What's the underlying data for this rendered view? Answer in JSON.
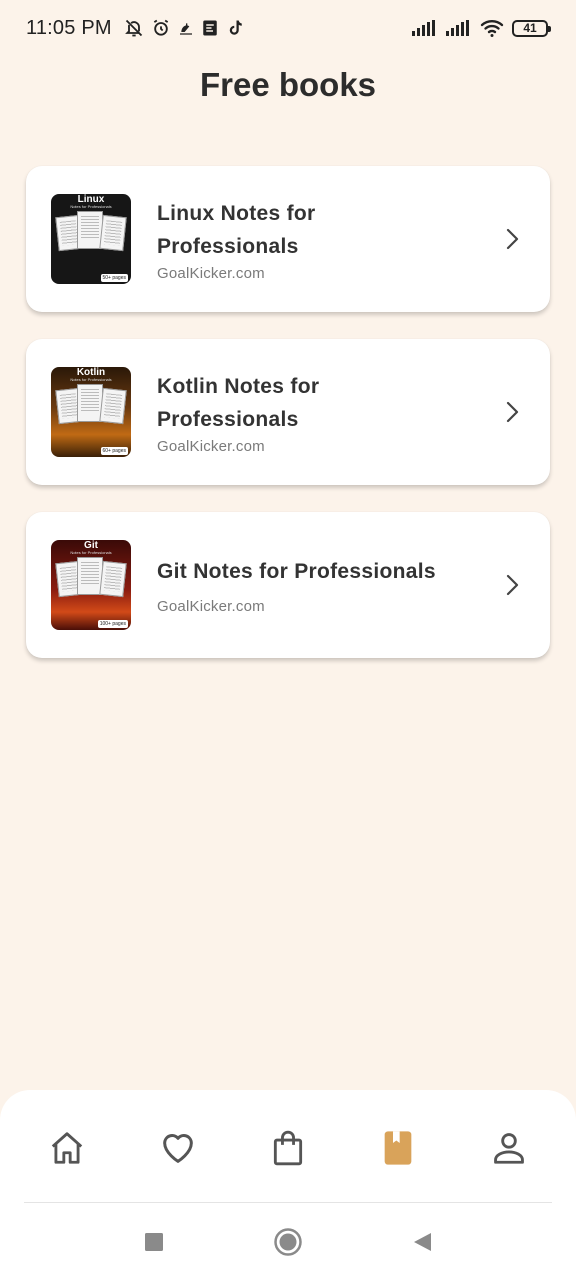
{
  "status_bar": {
    "time": "11:05 PM",
    "battery": "41",
    "left_icons": [
      "bell-off-icon",
      "alarm-icon",
      "notification-icon",
      "app-icon",
      "tiktok-icon"
    ],
    "right_icons": [
      "signal-icon",
      "signal-icon",
      "wifi-icon",
      "battery-icon"
    ]
  },
  "page": {
    "title": "Free books"
  },
  "books": [
    {
      "title_line1": "Linux Notes for",
      "title_line2": "Professionals",
      "publisher": "GoalKicker.com",
      "cover_title": "Linux",
      "cover_subtitle": "Notes for Professionals",
      "cover_badge": "50+ pages"
    },
    {
      "title_line1": "Kotlin Notes for",
      "title_line2": "Professionals",
      "publisher": "GoalKicker.com",
      "cover_title": "Kotlin",
      "cover_subtitle": "Notes for Professionals",
      "cover_badge": "60+ pages"
    },
    {
      "title_line1": "Git Notes for Professionals",
      "title_line2": "",
      "publisher": "GoalKicker.com",
      "cover_title": "Git",
      "cover_subtitle": "Notes for Professionals",
      "cover_badge": "100+ pages"
    }
  ],
  "bottom_nav": {
    "items": [
      "home-icon",
      "heart-icon",
      "shopping-bag-icon",
      "book-icon",
      "person-icon"
    ],
    "active_index": 3,
    "active_color": "#d9a35a",
    "inactive_color": "#555555"
  },
  "system_nav": [
    "recents-square-icon",
    "home-circle-icon",
    "back-triangle-icon"
  ],
  "colors": {
    "background": "#fcf3ea",
    "card": "#ffffff",
    "title_text": "#2c2c2c",
    "secondary_text": "#7a7a7a"
  }
}
